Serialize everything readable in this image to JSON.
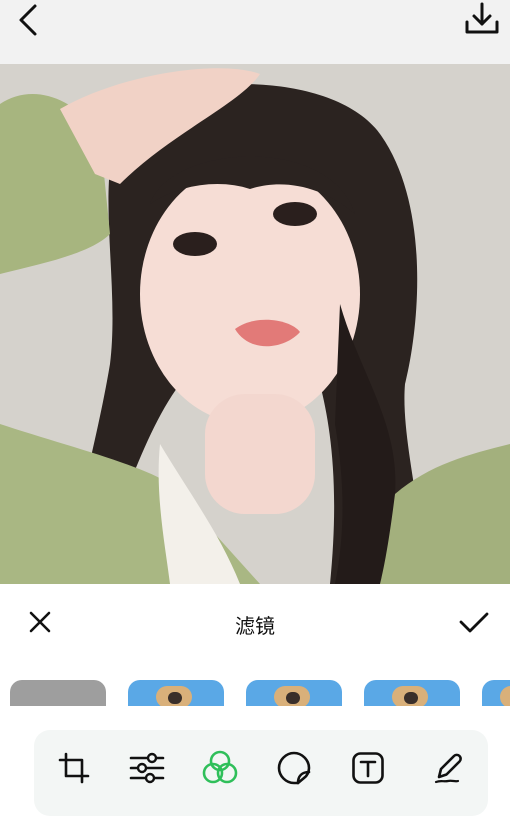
{
  "header": {
    "back_icon": "chevron-left-icon",
    "download_icon": "download-icon"
  },
  "editor": {
    "panel_title": "滤镜",
    "close_icon": "close-icon",
    "confirm_icon": "check-icon"
  },
  "filters": [
    {
      "name": "original",
      "color": "#9e9e9e"
    },
    {
      "name": "filter-1",
      "color": "#5aa8e6"
    },
    {
      "name": "filter-2",
      "color": "#5aa8e6"
    },
    {
      "name": "filter-3",
      "color": "#5aa8e6"
    },
    {
      "name": "filter-4",
      "color": "#5aa8e6"
    }
  ],
  "toolbar": {
    "tools": [
      {
        "name": "crop",
        "icon": "crop-icon"
      },
      {
        "name": "adjust",
        "icon": "sliders-icon"
      },
      {
        "name": "filter",
        "icon": "filter-icon",
        "active": true
      },
      {
        "name": "sticker",
        "icon": "sticker-icon"
      },
      {
        "name": "text",
        "icon": "text-icon"
      },
      {
        "name": "draw",
        "icon": "pen-icon"
      }
    ],
    "active_color": "#2fbf5a"
  }
}
